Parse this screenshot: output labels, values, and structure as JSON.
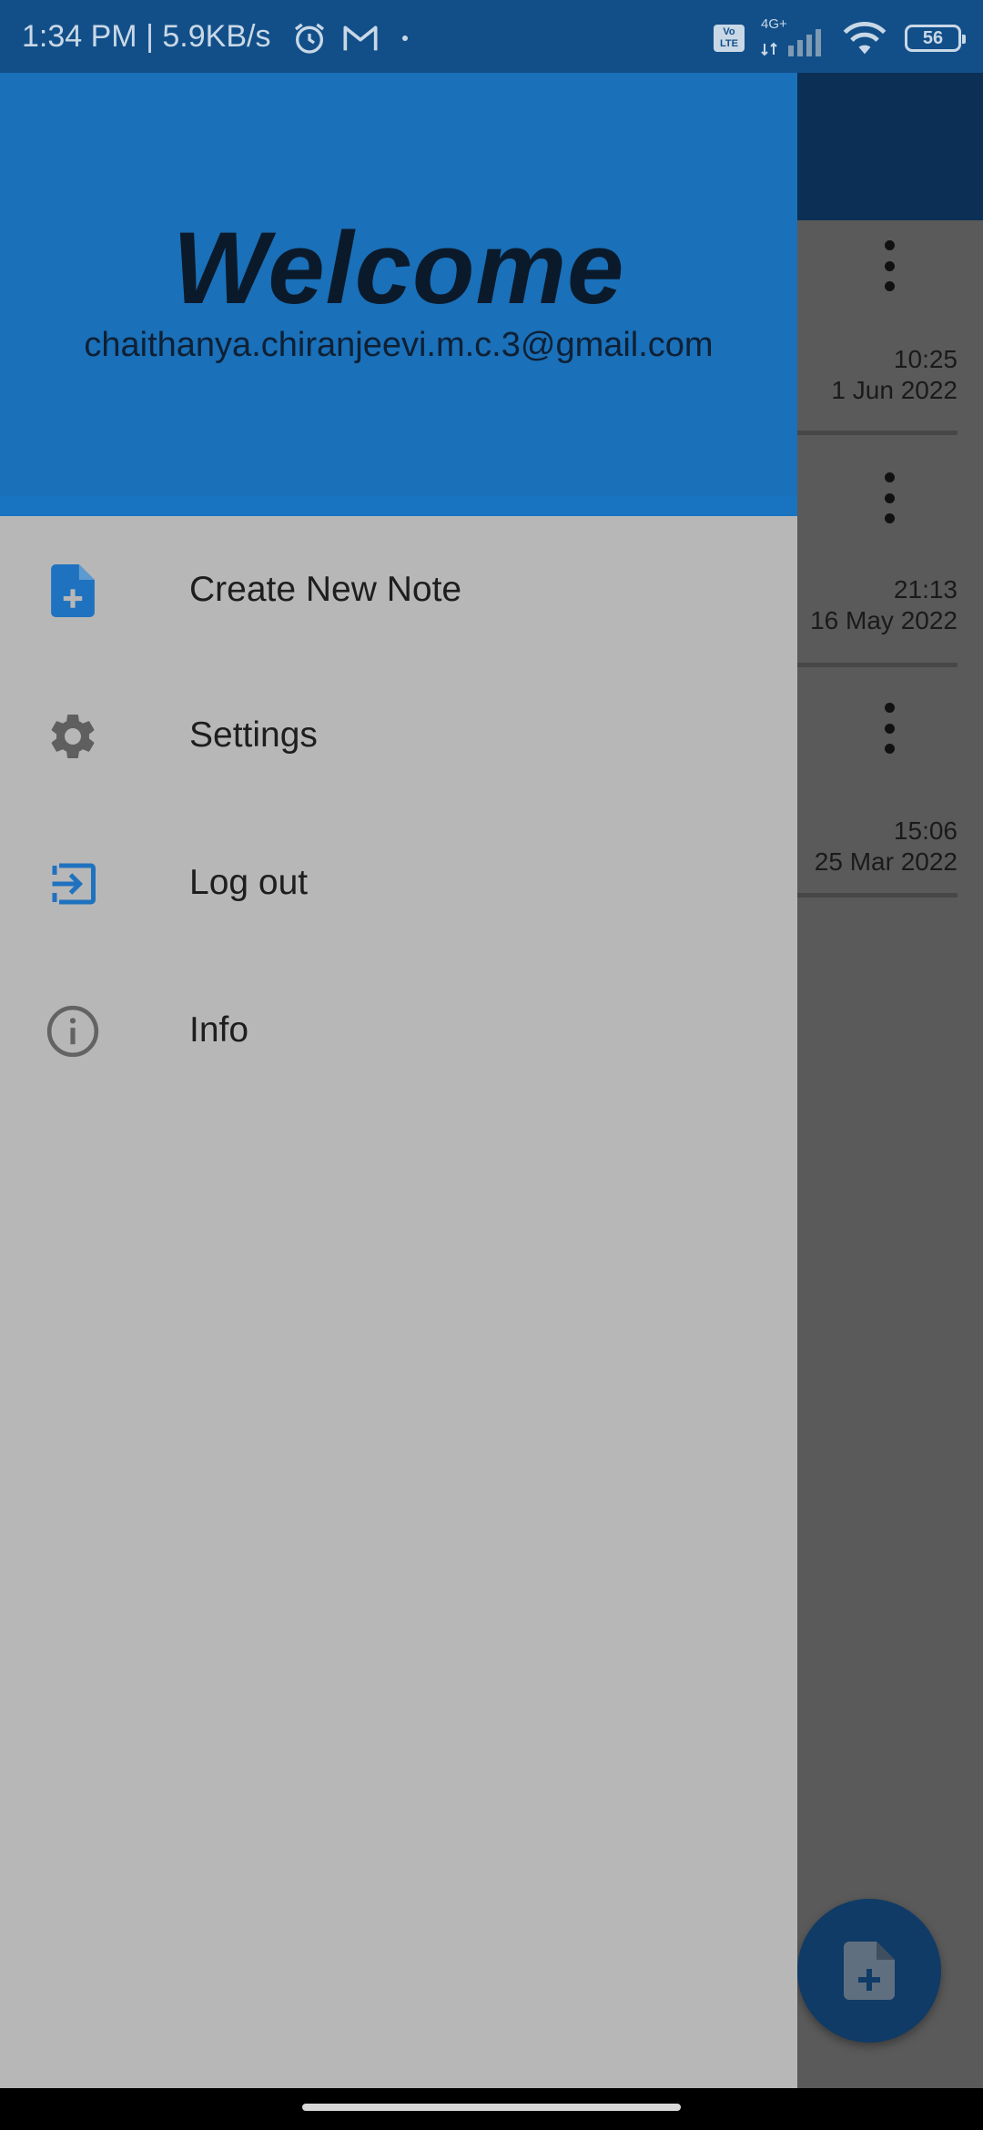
{
  "status_bar": {
    "time": "1:34 PM",
    "separator": "|",
    "net_speed": "5.9KB/s",
    "icons": [
      "alarm-icon",
      "gmail-icon",
      "dot-icon"
    ],
    "network_badge": "Vo LTE",
    "network_type": "4G+",
    "battery": "56"
  },
  "drawer": {
    "welcome": "Welcome",
    "email": "chaithanya.chiranjeevi.m.c.3@gmail.com",
    "items": [
      {
        "label": "Create New Note",
        "icon": "note-add-icon"
      },
      {
        "label": "Settings",
        "icon": "gear-icon"
      },
      {
        "label": "Log out",
        "icon": "logout-icon"
      },
      {
        "label": "Info",
        "icon": "info-icon"
      }
    ]
  },
  "notes": [
    {
      "time": "10:25",
      "date": "1 Jun 2022"
    },
    {
      "time": "21:13",
      "date": "16 May 2022"
    },
    {
      "time": "15:06",
      "date": "25 Mar 2022"
    }
  ],
  "colors": {
    "drawer_header": "#1a70b9",
    "drawer_bg": "#b7b7b7",
    "accent_icon": "#1f72bf",
    "status_bar": "#124f89"
  }
}
